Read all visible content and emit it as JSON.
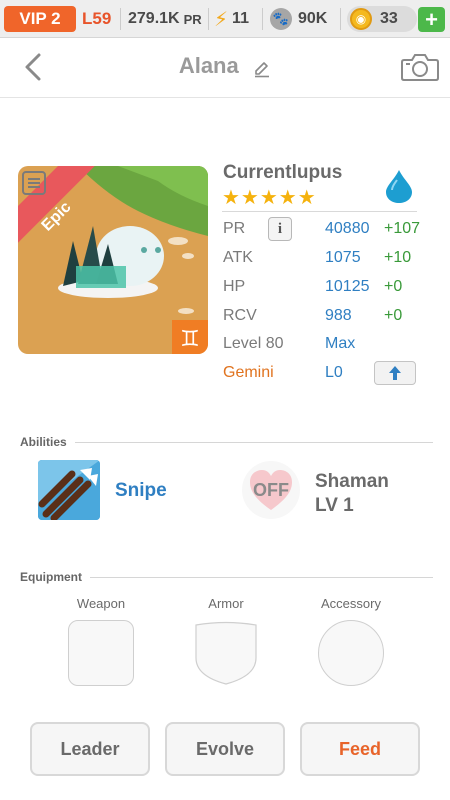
{
  "status_bar": {
    "vip": "VIP 2",
    "level": "L59",
    "pr_value": "279.1K",
    "pr_unit": "PR",
    "energy": "11",
    "paws": "90K",
    "coins": "33",
    "add_icon": "plus-icon"
  },
  "header": {
    "title": "Alana",
    "back_icon": "chevron-left-icon",
    "edit_icon": "pencil-icon",
    "camera_icon": "camera-icon"
  },
  "pet": {
    "rarity": "Epic",
    "name": "Currentlupus",
    "stars": "★★★★★",
    "star_count": 5,
    "element_icon": "water-drop-icon",
    "stats": [
      {
        "label": "PR",
        "value": "40880",
        "bonus": "+107"
      },
      {
        "label": "ATK",
        "value": "1075",
        "bonus": "+10"
      },
      {
        "label": "HP",
        "value": "10125",
        "bonus": "+0"
      },
      {
        "label": "RCV",
        "value": "988",
        "bonus": "+0"
      }
    ],
    "level_label": "Level 80",
    "level_value": "Max",
    "zodiac_label": "Gemini",
    "zodiac_level": "L0",
    "info_glyph": "i"
  },
  "abilities": {
    "section_label": "Abilities",
    "items": [
      {
        "name": "Snipe"
      },
      {
        "status": "OFF",
        "name_line1": "Shaman",
        "name_line2": "LV 1"
      }
    ]
  },
  "equipment": {
    "section_label": "Equipment",
    "slots": [
      "Weapon",
      "Armor",
      "Accessory"
    ]
  },
  "buttons": {
    "leader": "Leader",
    "evolve": "Evolve",
    "feed": "Feed"
  },
  "colors": {
    "accent_orange": "#e8642a",
    "stat_blue": "#2f7fc2",
    "bonus_green": "#3a9a3a",
    "star_gold": "#f5b20d"
  }
}
